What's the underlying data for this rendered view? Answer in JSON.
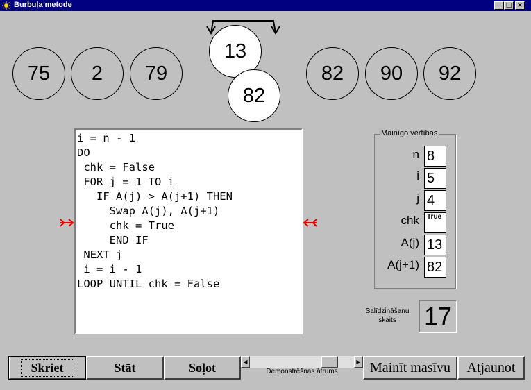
{
  "window": {
    "title": "Burbuļa metode",
    "minimize_glyph": "_",
    "maximize_glyph": "□",
    "close_glyph": "×"
  },
  "array": {
    "left": [
      "75",
      "2",
      "79"
    ],
    "compare_top": "13",
    "compare_bottom": "82",
    "right": [
      "82",
      "90",
      "92"
    ]
  },
  "code": {
    "lines": [
      "i = n - 1",
      "DO",
      " chk = False",
      " FOR j = 1 TO i",
      "   IF A(j) > A(j+1) THEN",
      "     Swap A(j), A(j+1)",
      "     chk = True",
      "     END IF",
      " NEXT j",
      " i = i - 1",
      "LOOP UNTIL chk = False"
    ]
  },
  "variables": {
    "legend": "Mainīgo vērtības",
    "items": [
      {
        "label": "n",
        "value": "8"
      },
      {
        "label": "i",
        "value": "5"
      },
      {
        "label": "j",
        "value": "4"
      },
      {
        "label": "chk",
        "value": "True"
      },
      {
        "label": "A(j)",
        "value": "13"
      },
      {
        "label": "A(j+1)",
        "value": "82"
      }
    ]
  },
  "comparisons": {
    "label_line1": "Salīdzināšanu",
    "label_line2": "skaits",
    "value": "17"
  },
  "buttons": {
    "run": "Skriet",
    "stop": "Stāt",
    "step": "Soļot",
    "change_array": "Mainīt masīvu",
    "reset": "Atjaunot"
  },
  "speed": {
    "label": "Demonstrēšnas ātrums",
    "level": 0.82
  },
  "colors": {
    "marker": "#e00000",
    "titlebar": "#000080"
  },
  "icons": {
    "app": "sun-icon",
    "marker": "arrow-marker-icon"
  }
}
